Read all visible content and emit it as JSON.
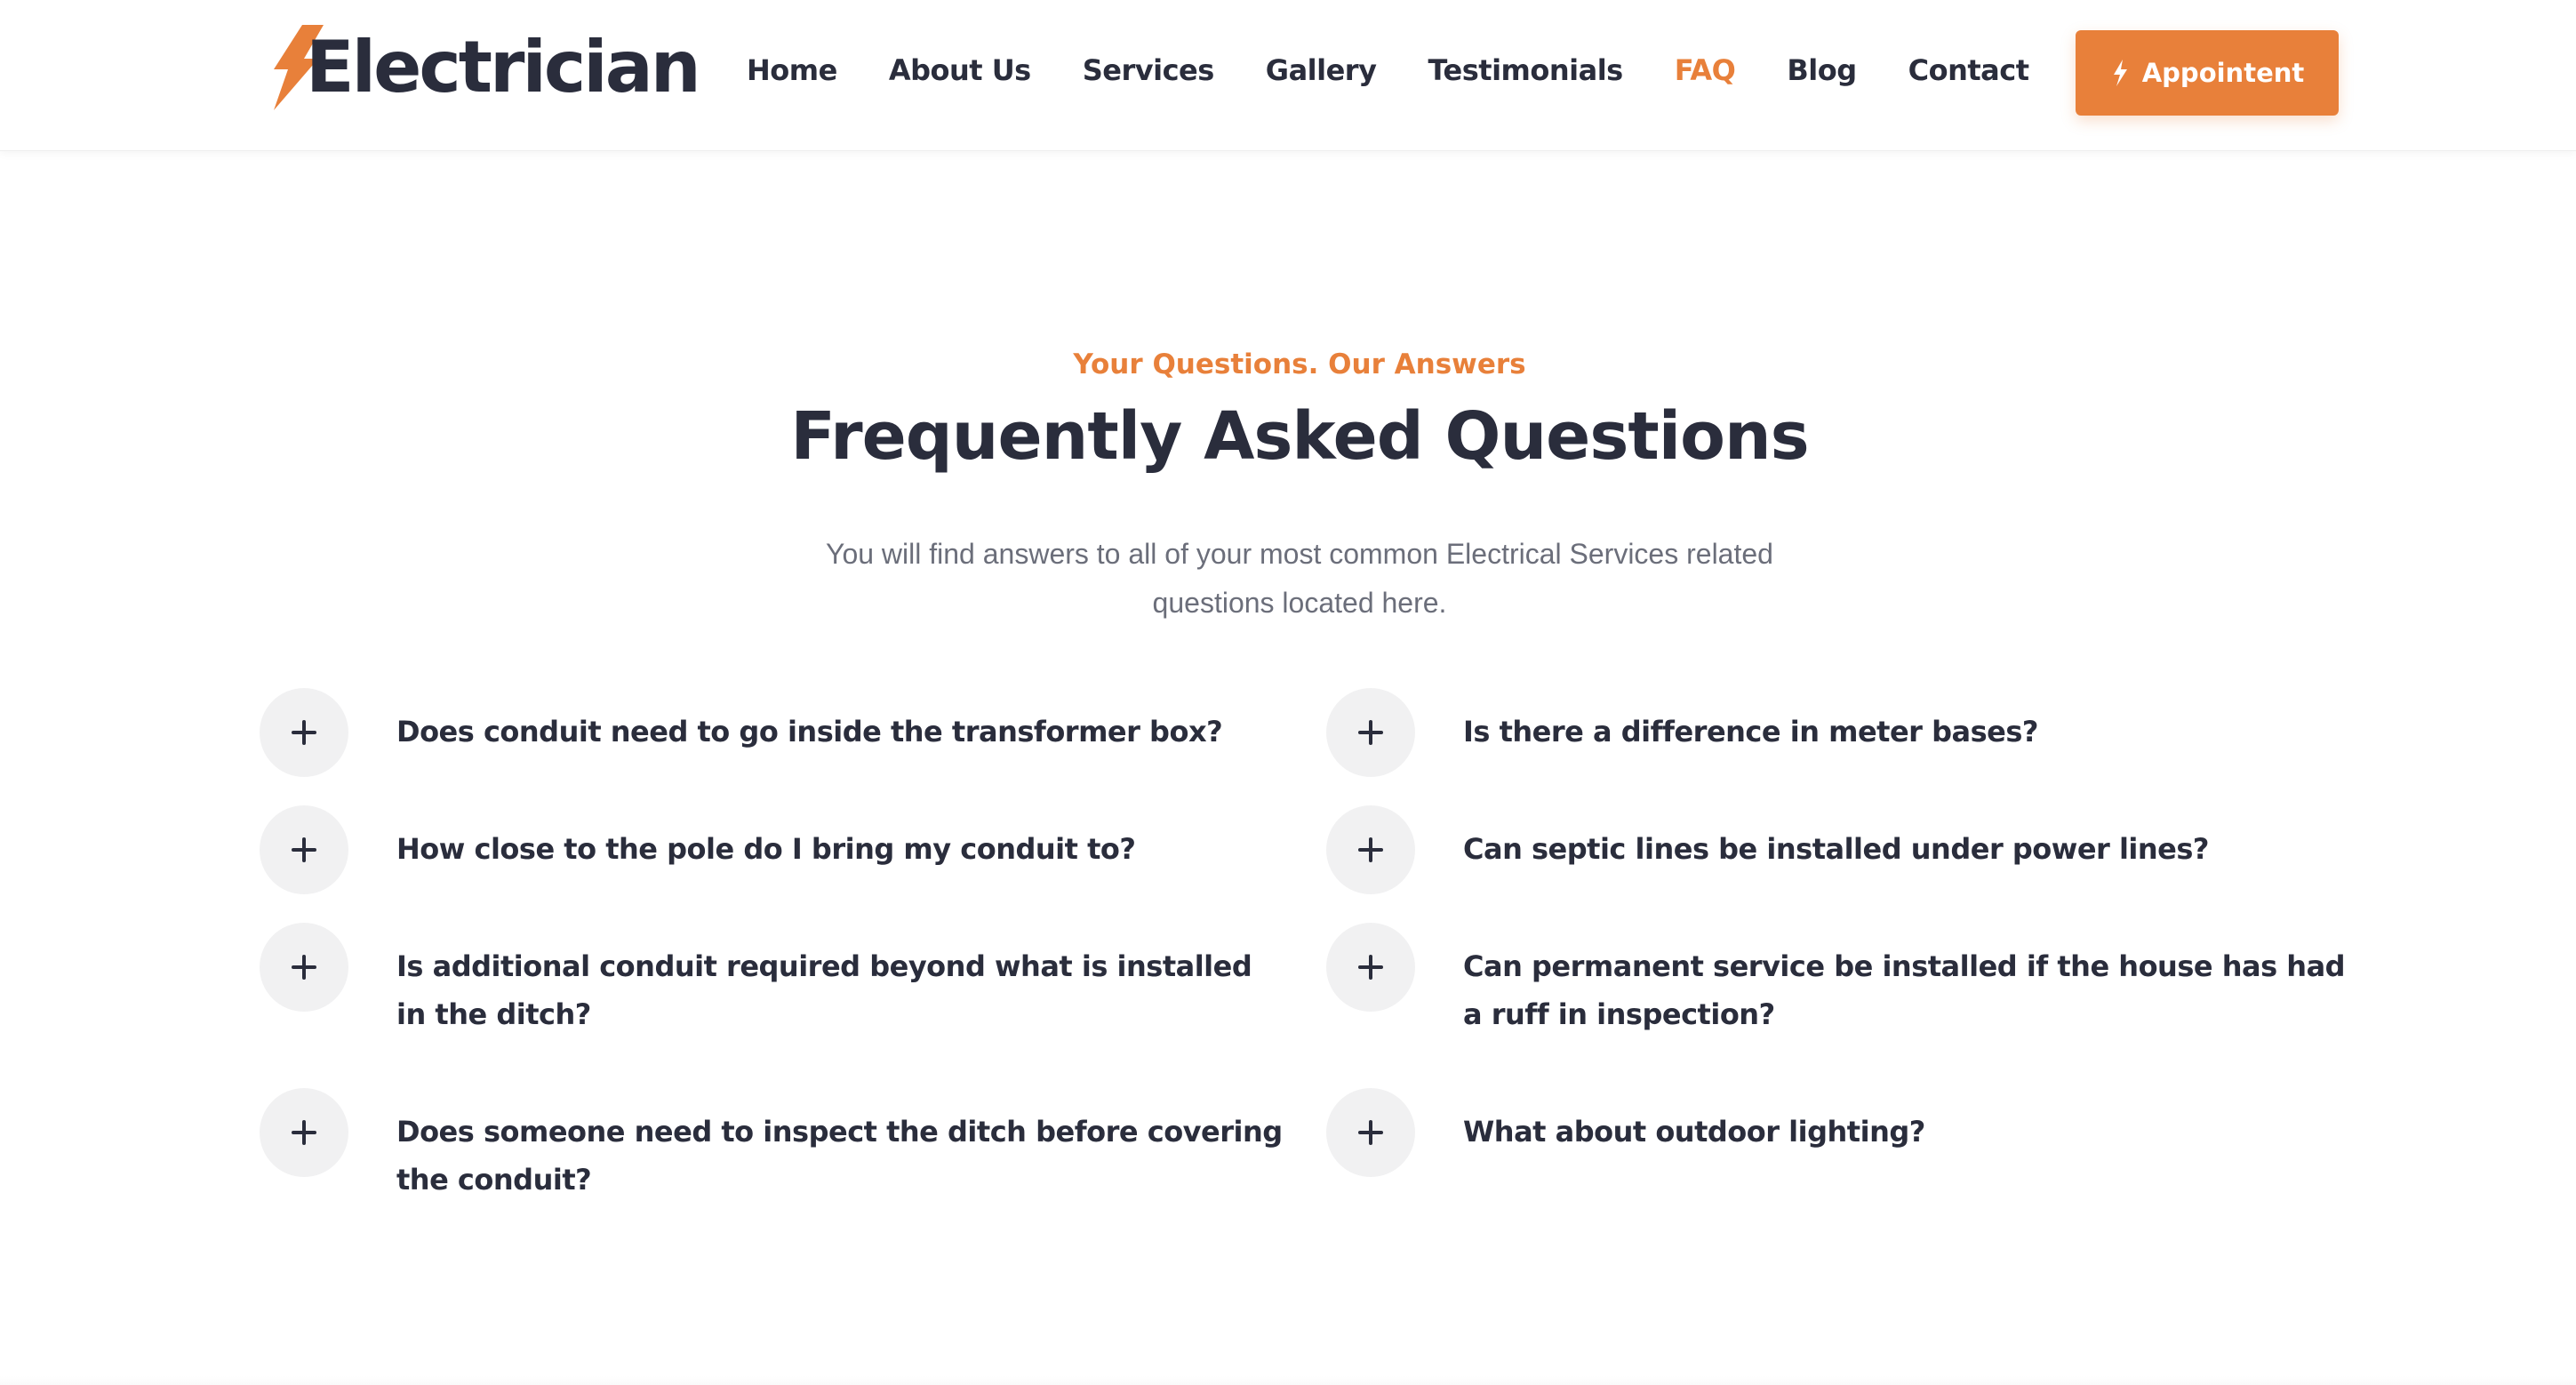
{
  "brand": {
    "name": "Electrician",
    "accent_color": "#e8803a",
    "text_color": "#2a2d3c"
  },
  "nav": {
    "items": [
      {
        "label": "Home",
        "active": false
      },
      {
        "label": "About Us",
        "active": false
      },
      {
        "label": "Services",
        "active": false
      },
      {
        "label": "Gallery",
        "active": false
      },
      {
        "label": "Testimonials",
        "active": false
      },
      {
        "label": "FAQ",
        "active": true
      },
      {
        "label": "Blog",
        "active": false
      },
      {
        "label": "Contact",
        "active": false
      }
    ]
  },
  "cta": {
    "label": "Appointent",
    "icon": "lightning-bolt-icon"
  },
  "section": {
    "kicker": "Your Questions. Our Answers",
    "title": "Frequently Asked Questions",
    "description": "You will find answers to all of your most common Electrical Services related questions located here."
  },
  "faq": {
    "toggle_icon": "plus-icon",
    "left": [
      {
        "question": "Does conduit need to go inside the transformer box?"
      },
      {
        "question": "How close to the pole do I bring my conduit to?"
      },
      {
        "question": "Is additional conduit required beyond what is installed in the ditch?"
      },
      {
        "question": "Does someone need to inspect the ditch before covering the conduit?"
      }
    ],
    "right": [
      {
        "question": "Is there a difference in meter bases?"
      },
      {
        "question": "Can septic lines be installed under power lines?"
      },
      {
        "question": "Can permanent service be installed if the house has had a ruff in inspection?"
      },
      {
        "question": "What about outdoor lighting?"
      }
    ]
  }
}
